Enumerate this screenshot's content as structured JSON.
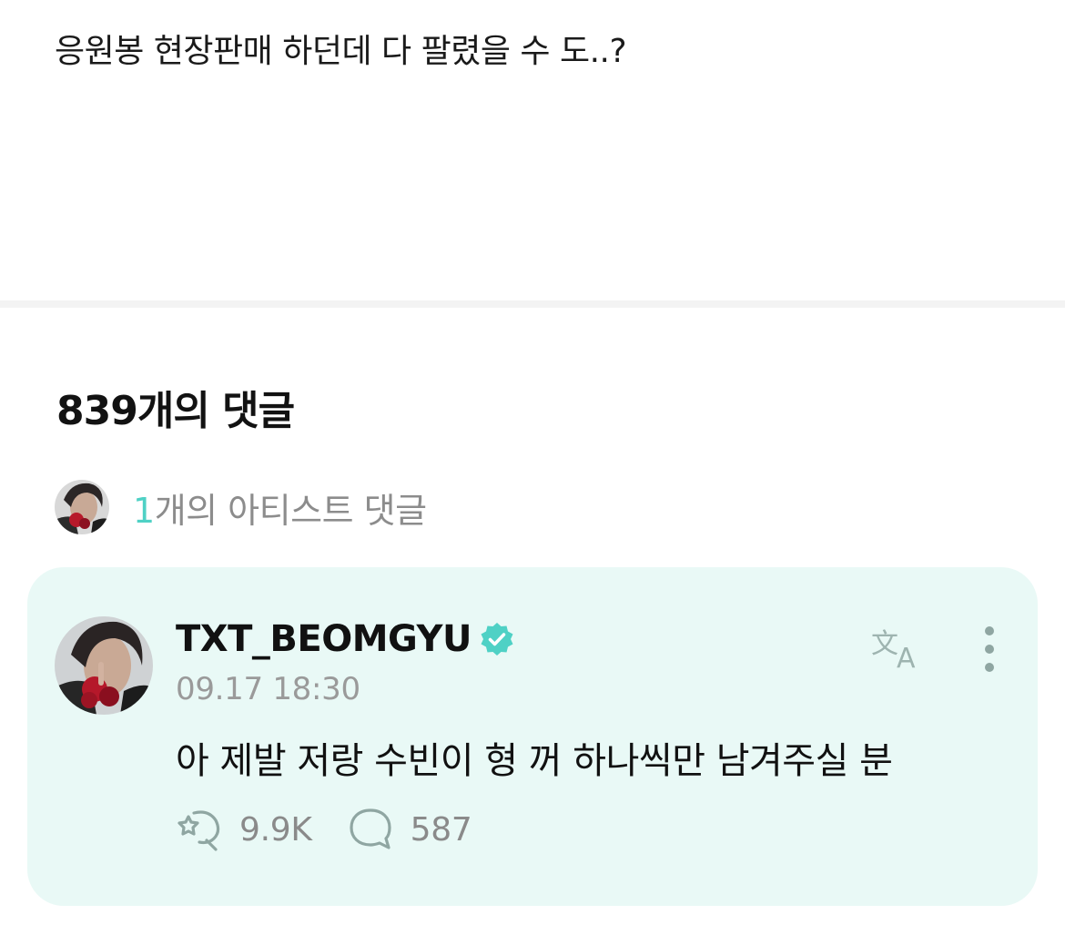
{
  "post": {
    "text": "응원봉 현장판매 하던데 다 팔렸을 수 도..?"
  },
  "comments_section": {
    "count_label": "839개의 댓글",
    "artist_comments": {
      "count": "1",
      "label": "개의 아티스트 댓글"
    }
  },
  "comment": {
    "author": "TXT_BEOMGYU",
    "verified": true,
    "timestamp": "09.17 18:30",
    "body": "아 제발 저랑 수빈이 형 꺼 하나씩만 남겨주실 분",
    "likes": "9.9K",
    "replies": "587",
    "icons": {
      "verified": "verified-badge-icon",
      "translate": "translate-icon",
      "more": "more-vertical-icon",
      "like": "cheer-like-icon",
      "reply": "reply-bubble-icon"
    }
  },
  "colors": {
    "accent": "#4fd1c5",
    "card_background": "#e9f9f6",
    "muted_text": "#8c8c8c",
    "icon_gray": "#8fa6a2"
  }
}
